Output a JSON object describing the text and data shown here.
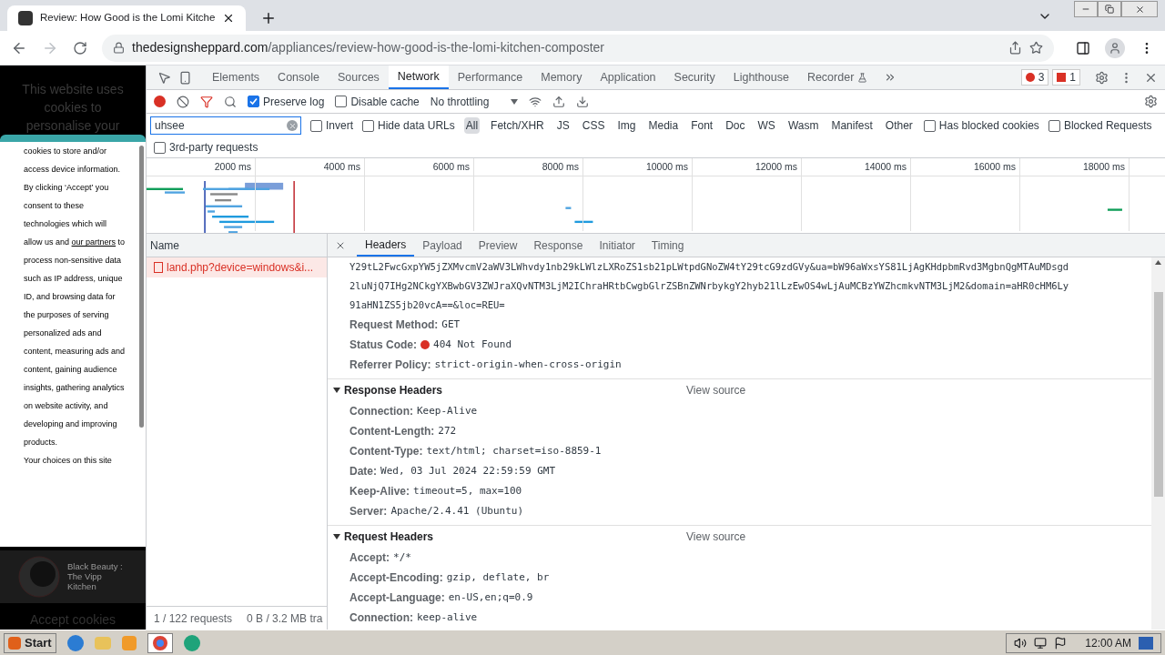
{
  "browser": {
    "tab_title": "Review: How Good is the Lomi Kitche",
    "url_domain": "thedesignsheppard.com",
    "url_path": "/appliances/review-how-good-is-the-lomi-kitchen-composter"
  },
  "page": {
    "heading": "This website uses cookies to personalise your",
    "dialog_paragraphs": [
      {
        "text": "cookies to store and/or access device information."
      },
      {
        "text": "By clicking ‘Accept’ you consent to these technologies which will allow us and",
        "link": "our partners",
        "text_after": "to process non-sensitive data such as IP address, unique ID, and browsing data for the purposes of serving personalized ads and content, measuring ads and content, gaining audience insights, gathering analytics on website activity, and developing and improving products."
      },
      {
        "text": "Your choices on this site"
      }
    ],
    "card_lines": [
      "Black Beauty :",
      "The Vipp",
      "Kitchen"
    ],
    "accept_button": "Accept cookies"
  },
  "devtools": {
    "tabs": [
      {
        "label": "Elements",
        "selected": false
      },
      {
        "label": "Console",
        "selected": false
      },
      {
        "label": "Sources",
        "selected": false
      },
      {
        "label": "Network",
        "selected": true
      },
      {
        "label": "Performance",
        "selected": false
      },
      {
        "label": "Memory",
        "selected": false
      },
      {
        "label": "Application",
        "selected": false
      },
      {
        "label": "Security",
        "selected": false
      },
      {
        "label": "Lighthouse",
        "selected": false
      },
      {
        "label": "Recorder",
        "selected": false
      }
    ],
    "error_count": "3",
    "issue_count": "1",
    "recording": true,
    "preserve_log": {
      "label": "Preserve log",
      "checked": true
    },
    "disable_cache": {
      "label": "Disable cache",
      "checked": false
    },
    "throttling": "No throttling",
    "filter": {
      "value": "uhsee"
    },
    "filter_options": [
      {
        "label": "Invert",
        "checked": false
      },
      {
        "label": "Hide data URLs",
        "checked": false
      }
    ],
    "type_filters": [
      {
        "label": "All",
        "selected": true
      },
      {
        "label": "Fetch/XHR",
        "selected": false
      },
      {
        "label": "JS",
        "selected": false
      },
      {
        "label": "CSS",
        "selected": false
      },
      {
        "label": "Img",
        "selected": false
      },
      {
        "label": "Media",
        "selected": false
      },
      {
        "label": "Font",
        "selected": false
      },
      {
        "label": "Doc",
        "selected": false
      },
      {
        "label": "WS",
        "selected": false
      },
      {
        "label": "Wasm",
        "selected": false
      },
      {
        "label": "Manifest",
        "selected": false
      },
      {
        "label": "Other",
        "selected": false
      }
    ],
    "blocked_options": [
      {
        "label": "Has blocked cookies",
        "checked": false
      },
      {
        "label": "Blocked Requests",
        "checked": false
      }
    ],
    "third_party": {
      "label": "3rd-party requests",
      "checked": false
    },
    "overview_ticks": [
      "2000 ms",
      "4000 ms",
      "6000 ms",
      "8000 ms",
      "10000 ms",
      "12000 ms",
      "14000 ms",
      "16000 ms",
      "18000 ms"
    ],
    "requests": {
      "column": "Name",
      "rows": [
        {
          "name": "land.php?device=windows&i...",
          "selected": true,
          "failed": true
        }
      ],
      "count": "1 / 122 requests",
      "transferred": "0 B / 3.2 MB tra"
    },
    "detail_tabs": [
      {
        "label": "Headers",
        "selected": true
      },
      {
        "label": "Payload",
        "selected": false
      },
      {
        "label": "Preview",
        "selected": false
      },
      {
        "label": "Response",
        "selected": false
      },
      {
        "label": "Initiator",
        "selected": false
      },
      {
        "label": "Timing",
        "selected": false
      }
    ],
    "url_lines": [
      "Y29tL2FwcGxpYW5jZXMvcmV2aWV3LWhvdy1nb29kLWlzLXRoZS1sb21pLWtpdGNoZW4tY29tcG9zdGVy&ua=bW96aWxsYS81LjAgKHdpbmRvd3MgbnQgMTAuMDsgd",
      "2luNjQ7IHg2NCkgYXBwbGV3ZWJraXQvNTM3LjM2IChraHRtbCwgbGlrZSBnZWNrbykgY2hyb21lLzEwOS4wLjAuMCBzYWZhcmkvNTM3LjM2&domain=aHR0cHM6Ly",
      "91aHN1ZS5jb20vcA==&loc=REU="
    ],
    "general": [
      {
        "key": "Request Method:",
        "value": "GET",
        "kind": "plain"
      },
      {
        "key": "Status Code:",
        "value": "404 Not Found",
        "kind": "status"
      },
      {
        "key": "Referrer Policy:",
        "value": "strict-origin-when-cross-origin",
        "kind": "plain"
      }
    ],
    "sections": [
      {
        "title": "Response Headers",
        "expanded": true,
        "view_source": "View source",
        "headers": [
          {
            "key": "Connection:",
            "value": "Keep-Alive"
          },
          {
            "key": "Content-Length:",
            "value": "272"
          },
          {
            "key": "Content-Type:",
            "value": "text/html; charset=iso-8859-1"
          },
          {
            "key": "Date:",
            "value": "Wed, 03 Jul 2024 22:59:59 GMT"
          },
          {
            "key": "Keep-Alive:",
            "value": "timeout=5, max=100"
          },
          {
            "key": "Server:",
            "value": "Apache/2.4.41 (Ubuntu)"
          }
        ]
      },
      {
        "title": "Request Headers",
        "expanded": true,
        "view_source": "View source",
        "headers": [
          {
            "key": "Accept:",
            "value": "*/*"
          },
          {
            "key": "Accept-Encoding:",
            "value": "gzip, deflate, br"
          },
          {
            "key": "Accept-Language:",
            "value": "en-US,en;q=0.9"
          },
          {
            "key": "Connection:",
            "value": "keep-alive"
          }
        ]
      }
    ]
  },
  "taskbar": {
    "start": "Start",
    "clock": "12:00 AM"
  }
}
